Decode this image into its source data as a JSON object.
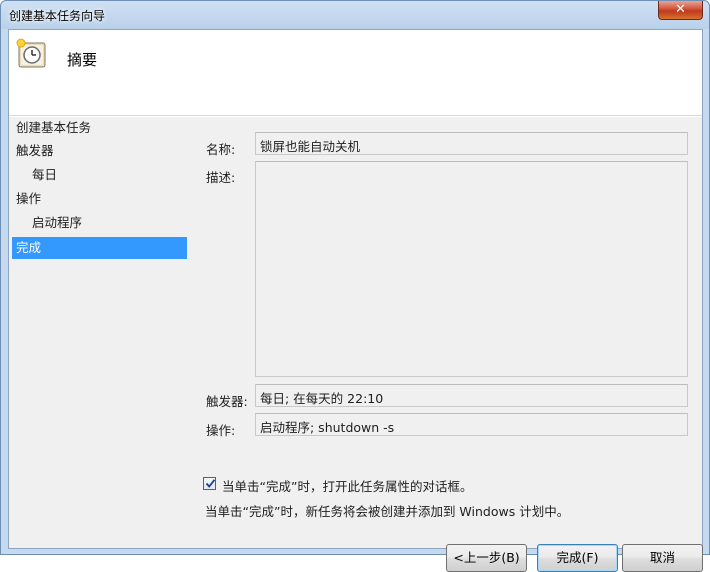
{
  "window": {
    "title": "创建基本任务向导",
    "close_glyph": "✕"
  },
  "header": {
    "title": "摘要"
  },
  "nav": {
    "items": [
      {
        "label": "创建基本任务"
      },
      {
        "label": "触发器"
      },
      {
        "label": "每日"
      },
      {
        "label": "操作"
      },
      {
        "label": "启动程序"
      },
      {
        "label": "完成"
      }
    ],
    "active_index": 5
  },
  "summary": {
    "name_label": "名称:",
    "name_value": "锁屏也能自动关机",
    "desc_label": "描述:",
    "desc_value": "",
    "trigger_label": "触发器:",
    "trigger_value": "每日; 在每天的 22:10",
    "action_label": "操作:",
    "action_value": "启动程序; shutdown -s"
  },
  "open_props": {
    "checked": true,
    "label": "当单击“完成”时，打开此任务属性的对话框。"
  },
  "note": "当单击“完成”时，新任务将会被创建并添加到 Windows 计划中。",
  "buttons": {
    "back": "<上一步(B)",
    "finish": "完成(F)",
    "cancel": "取消"
  },
  "colors": {
    "selection": "#3399ff",
    "chrome": "#c5d9ef",
    "panel": "#f0f0f0"
  }
}
